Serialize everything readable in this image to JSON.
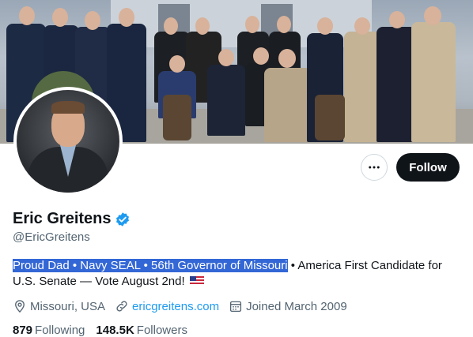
{
  "profile": {
    "display_name": "Eric Greitens",
    "handle": "@EricGreitens",
    "bio_highlighted": "Proud Dad • Navy SEAL • 56th Governor of Missouri",
    "bio_rest": " • America First Candidate for U.S. Senate — Vote August 2nd! ",
    "location": "Missouri, USA",
    "website": "ericgreitens.com",
    "joined": "Joined March 2009",
    "following_count": "879",
    "following_label": "Following",
    "followers_count": "148.5K",
    "followers_label": "Followers"
  },
  "actions": {
    "follow_label": "Follow"
  },
  "colors": {
    "accent": "#1d9bf0",
    "highlight": "#3367d6",
    "button_dark": "#0f1419",
    "secondary_text": "#536471"
  },
  "icons": {
    "verified": "verified-badge-icon",
    "location": "location-pin-icon",
    "link": "link-icon",
    "calendar": "calendar-icon",
    "more": "more-horizontal-icon"
  }
}
